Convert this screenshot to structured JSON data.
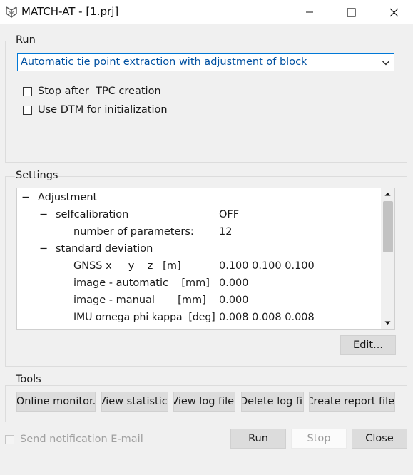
{
  "window": {
    "title": "MATCH-AT - [1.prj]",
    "icon": "match-at-app-icon",
    "controls": [
      "minimize-icon",
      "maximize-icon",
      "close-icon"
    ]
  },
  "run_group": {
    "title": "Run",
    "mode_select": {
      "value": "Automatic tie point extraction with adjustment of block"
    },
    "options": [
      {
        "label": "Stop after  TPC creation",
        "checked": false
      },
      {
        "label": "Use DTM for initialization",
        "checked": false
      }
    ]
  },
  "settings_group": {
    "title": "Settings",
    "tree": [
      {
        "label": "Adjustment",
        "value": "",
        "level": 0,
        "toggle": "−"
      },
      {
        "label": "selfcalibration",
        "value": "OFF",
        "level": 1,
        "toggle": "−"
      },
      {
        "label": "number of parameters:",
        "value": "12",
        "level": 2,
        "toggle": ""
      },
      {
        "label": "standard deviation",
        "value": "",
        "level": 1,
        "toggle": "−"
      },
      {
        "label": "GNSS x     y    z   [m]",
        "value": "0.100 0.100 0.100",
        "level": 2,
        "toggle": ""
      },
      {
        "label": "image - automatic    [mm]",
        "value": "0.000",
        "level": 2,
        "toggle": ""
      },
      {
        "label": "image - manual       [mm]",
        "value": "0.000",
        "level": 2,
        "toggle": ""
      },
      {
        "label": "IMU omega phi kappa  [deg]",
        "value": "0.008 0.008 0.008",
        "level": 2,
        "toggle": ""
      }
    ],
    "edit_button": "Edit..."
  },
  "tools_group": {
    "title": "Tools",
    "buttons": [
      "Online monitor.",
      "View statistic.",
      "View log file.",
      "Delete log fil",
      "Create report file."
    ]
  },
  "footer": {
    "notify_label": "Send notification E-mail",
    "notify_enabled": false,
    "run_button": "Run",
    "stop_button": "Stop",
    "stop_enabled": false,
    "close_button": "Close"
  },
  "colors": {
    "accent": "#0078d7",
    "combo_text": "#0050a0",
    "window_bg": "#f0f0f0",
    "button_bg": "#dcdcdc"
  }
}
